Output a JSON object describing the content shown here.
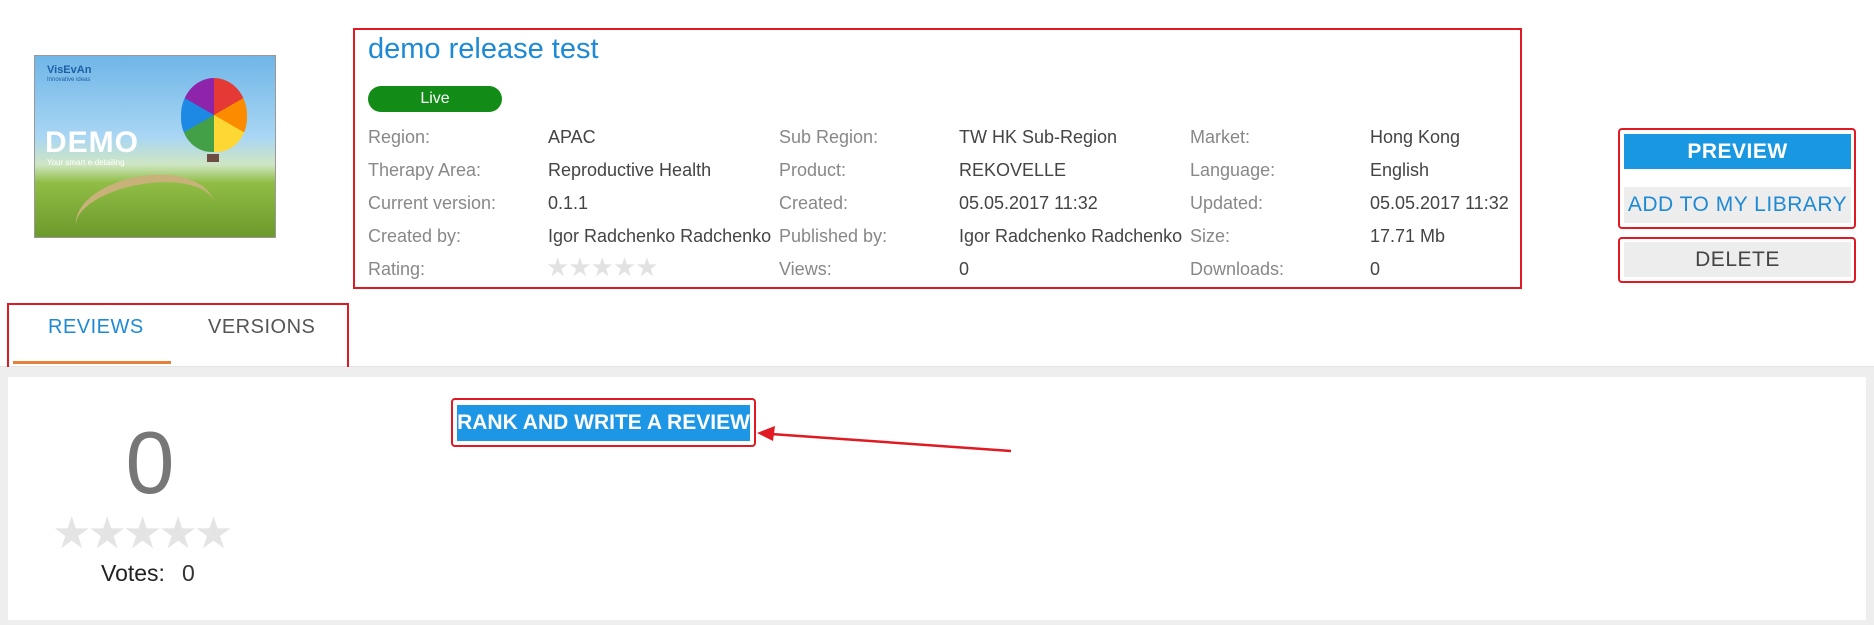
{
  "asset": {
    "title": "demo release test",
    "status": "Live",
    "thumbnail": {
      "logo_text": "VisEvAn",
      "logo_sub": "Innovative ideas",
      "headline": "DEMO",
      "tagline": "Your smart e-detailing"
    }
  },
  "meta": {
    "region": {
      "label": "Region:",
      "value": "APAC"
    },
    "sub_region": {
      "label": "Sub Region:",
      "value": "TW HK Sub-Region"
    },
    "market": {
      "label": "Market:",
      "value": "Hong Kong"
    },
    "therapy_area": {
      "label": "Therapy Area:",
      "value": "Reproductive Health"
    },
    "product": {
      "label": "Product:",
      "value": "REKOVELLE"
    },
    "language": {
      "label": "Language:",
      "value": "English"
    },
    "current_version": {
      "label": "Current version:",
      "value": "0.1.1"
    },
    "created": {
      "label": "Created:",
      "value": "05.05.2017 11:32"
    },
    "updated": {
      "label": "Updated:",
      "value": "05.05.2017 11:32"
    },
    "created_by": {
      "label": "Created by:",
      "value": "Igor Radchenko Radchenko"
    },
    "published_by": {
      "label": "Published by:",
      "value": "Igor Radchenko Radchenko"
    },
    "size": {
      "label": "Size:",
      "value": "17.71 Mb"
    },
    "rating": {
      "label": "Rating:",
      "stars": "★★★★★",
      "value": 0,
      "max": 5
    },
    "views": {
      "label": "Views:",
      "value": "0"
    },
    "downloads": {
      "label": "Downloads:",
      "value": "0"
    }
  },
  "actions": {
    "preview": "PREVIEW",
    "add_to_library": "ADD TO MY LIBRARY",
    "delete": "DELETE"
  },
  "tabs": [
    {
      "label": "REVIEWS",
      "active": true
    },
    {
      "label": "VERSIONS",
      "active": false
    }
  ],
  "reviews": {
    "score": "0",
    "stars": "★★★★★",
    "votes_label": "Votes:",
    "votes_value": "0",
    "rank_button": "RANK AND WRITE A REVIEW"
  },
  "colors": {
    "accent": "#1e8ad6",
    "live_badge": "#128c16",
    "highlight": "#e01a22",
    "tab_underline": "#e8803a"
  }
}
